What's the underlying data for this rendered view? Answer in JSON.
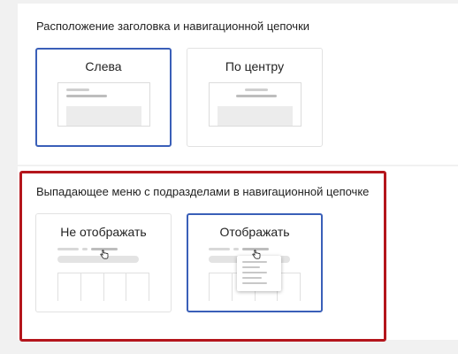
{
  "section_header": {
    "title": "Расположение заголовка и навигационной цепочки",
    "options": [
      {
        "label": "Слева",
        "selected": true
      },
      {
        "label": "По центру",
        "selected": false
      }
    ]
  },
  "section_dropdown": {
    "title": "Выпадающее меню с подразделами в навигационной цепочке",
    "options": [
      {
        "label": "Не отображать",
        "selected": false
      },
      {
        "label": "Отображать",
        "selected": true
      }
    ]
  },
  "colors": {
    "selected_border": "#3a5fb8",
    "highlight_border": "#b4161c"
  },
  "icons": {
    "cursor": "hand-pointer-icon"
  }
}
